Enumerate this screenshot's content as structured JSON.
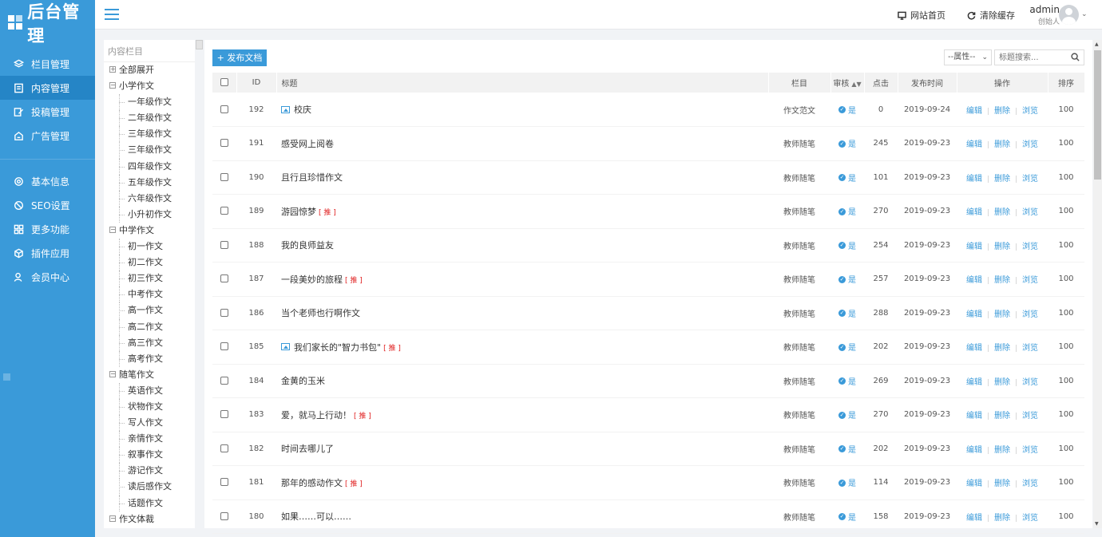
{
  "logo": {
    "text": "后台管理"
  },
  "sidebar": {
    "group1": [
      {
        "label": "栏目管理",
        "icon": "layers-icon",
        "active": false
      },
      {
        "label": "内容管理",
        "icon": "document-icon",
        "active": true
      },
      {
        "label": "投稿管理",
        "icon": "edit-icon",
        "active": false
      },
      {
        "label": "广告管理",
        "icon": "ad-icon",
        "active": false
      }
    ],
    "group2": [
      {
        "label": "基本信息",
        "icon": "gear-icon"
      },
      {
        "label": "SEO设置",
        "icon": "seo-icon"
      },
      {
        "label": "更多功能",
        "icon": "grid-icon"
      },
      {
        "label": "插件应用",
        "icon": "plugin-icon"
      },
      {
        "label": "会员中心",
        "icon": "user-icon"
      }
    ]
  },
  "header": {
    "site_home": "网站首页",
    "clear_cache": "清除缓存",
    "user_name": "admin",
    "user_role": "创始人"
  },
  "tree": {
    "title": "内容栏目",
    "items": [
      {
        "label": "全部展开",
        "level": 0,
        "toggle": "+"
      },
      {
        "label": "小学作文",
        "level": 0,
        "toggle": "−"
      },
      {
        "label": "一年级作文",
        "level": 1
      },
      {
        "label": "二年级作文",
        "level": 1
      },
      {
        "label": "三年级作文",
        "level": 1
      },
      {
        "label": "三年级作文",
        "level": 1
      },
      {
        "label": "四年级作文",
        "level": 1
      },
      {
        "label": "五年级作文",
        "level": 1
      },
      {
        "label": "六年级作文",
        "level": 1
      },
      {
        "label": "小升初作文",
        "level": 1
      },
      {
        "label": "中学作文",
        "level": 0,
        "toggle": "−"
      },
      {
        "label": "初一作文",
        "level": 1
      },
      {
        "label": "初二作文",
        "level": 1
      },
      {
        "label": "初三作文",
        "level": 1
      },
      {
        "label": "中考作文",
        "level": 1
      },
      {
        "label": "高一作文",
        "level": 1
      },
      {
        "label": "高二作文",
        "level": 1
      },
      {
        "label": "高三作文",
        "level": 1
      },
      {
        "label": "高考作文",
        "level": 1
      },
      {
        "label": "随笔作文",
        "level": 0,
        "toggle": "−"
      },
      {
        "label": "英语作文",
        "level": 1
      },
      {
        "label": "状物作文",
        "level": 1
      },
      {
        "label": "写人作文",
        "level": 1
      },
      {
        "label": "亲情作文",
        "level": 1
      },
      {
        "label": "叙事作文",
        "level": 1
      },
      {
        "label": "游记作文",
        "level": 1
      },
      {
        "label": "读后感作文",
        "level": 1
      },
      {
        "label": "话题作文",
        "level": 1
      },
      {
        "label": "作文体裁",
        "level": 0,
        "toggle": "−"
      }
    ]
  },
  "toolbar": {
    "publish_label": "+ 发布文档",
    "attr_select": "--属性--",
    "search_placeholder": "标题搜索..."
  },
  "table": {
    "headers": [
      "ID",
      "标题",
      "栏目",
      "审核",
      "点击",
      "发布时间",
      "操作",
      "排序"
    ],
    "ops": [
      "编辑",
      "删除",
      "浏览"
    ],
    "audit_yes": "是",
    "rec_tag": "[ 推 ]",
    "rows": [
      {
        "id": "192",
        "title": "校庆",
        "img": true,
        "rec": false,
        "column": "作文范文",
        "clicks": "0",
        "date": "2019-09-24",
        "sort": "100"
      },
      {
        "id": "191",
        "title": "感受网上阅卷",
        "img": false,
        "rec": false,
        "column": "教师随笔",
        "clicks": "245",
        "date": "2019-09-23",
        "sort": "100"
      },
      {
        "id": "190",
        "title": "且行且珍惜作文",
        "img": false,
        "rec": false,
        "column": "教师随笔",
        "clicks": "101",
        "date": "2019-09-23",
        "sort": "100"
      },
      {
        "id": "189",
        "title": "游园惊梦",
        "img": false,
        "rec": true,
        "column": "教师随笔",
        "clicks": "270",
        "date": "2019-09-23",
        "sort": "100"
      },
      {
        "id": "188",
        "title": "我的良师益友",
        "img": false,
        "rec": false,
        "column": "教师随笔",
        "clicks": "254",
        "date": "2019-09-23",
        "sort": "100"
      },
      {
        "id": "187",
        "title": "一段美妙的旅程",
        "img": false,
        "rec": true,
        "column": "教师随笔",
        "clicks": "257",
        "date": "2019-09-23",
        "sort": "100"
      },
      {
        "id": "186",
        "title": "当个老师也行啊作文",
        "img": false,
        "rec": false,
        "column": "教师随笔",
        "clicks": "288",
        "date": "2019-09-23",
        "sort": "100"
      },
      {
        "id": "185",
        "title": "我们家长的\"智力书包\"",
        "img": true,
        "rec": true,
        "column": "教师随笔",
        "clicks": "202",
        "date": "2019-09-23",
        "sort": "100"
      },
      {
        "id": "184",
        "title": "金黄的玉米",
        "img": false,
        "rec": false,
        "column": "教师随笔",
        "clicks": "269",
        "date": "2019-09-23",
        "sort": "100"
      },
      {
        "id": "183",
        "title": "爱，就马上行动！",
        "img": false,
        "rec": true,
        "column": "教师随笔",
        "clicks": "270",
        "date": "2019-09-23",
        "sort": "100"
      },
      {
        "id": "182",
        "title": "时间去哪儿了",
        "img": false,
        "rec": false,
        "column": "教师随笔",
        "clicks": "202",
        "date": "2019-09-23",
        "sort": "100"
      },
      {
        "id": "181",
        "title": "那年的感动作文",
        "img": false,
        "rec": true,
        "column": "教师随笔",
        "clicks": "114",
        "date": "2019-09-23",
        "sort": "100"
      },
      {
        "id": "180",
        "title": "如果……可以……",
        "img": false,
        "rec": false,
        "column": "教师随笔",
        "clicks": "158",
        "date": "2019-09-23",
        "sort": "100"
      }
    ]
  },
  "colors": {
    "accent": "#3a9ad9",
    "sidebar_active": "#2585c6",
    "rec_red": "#e02020"
  }
}
